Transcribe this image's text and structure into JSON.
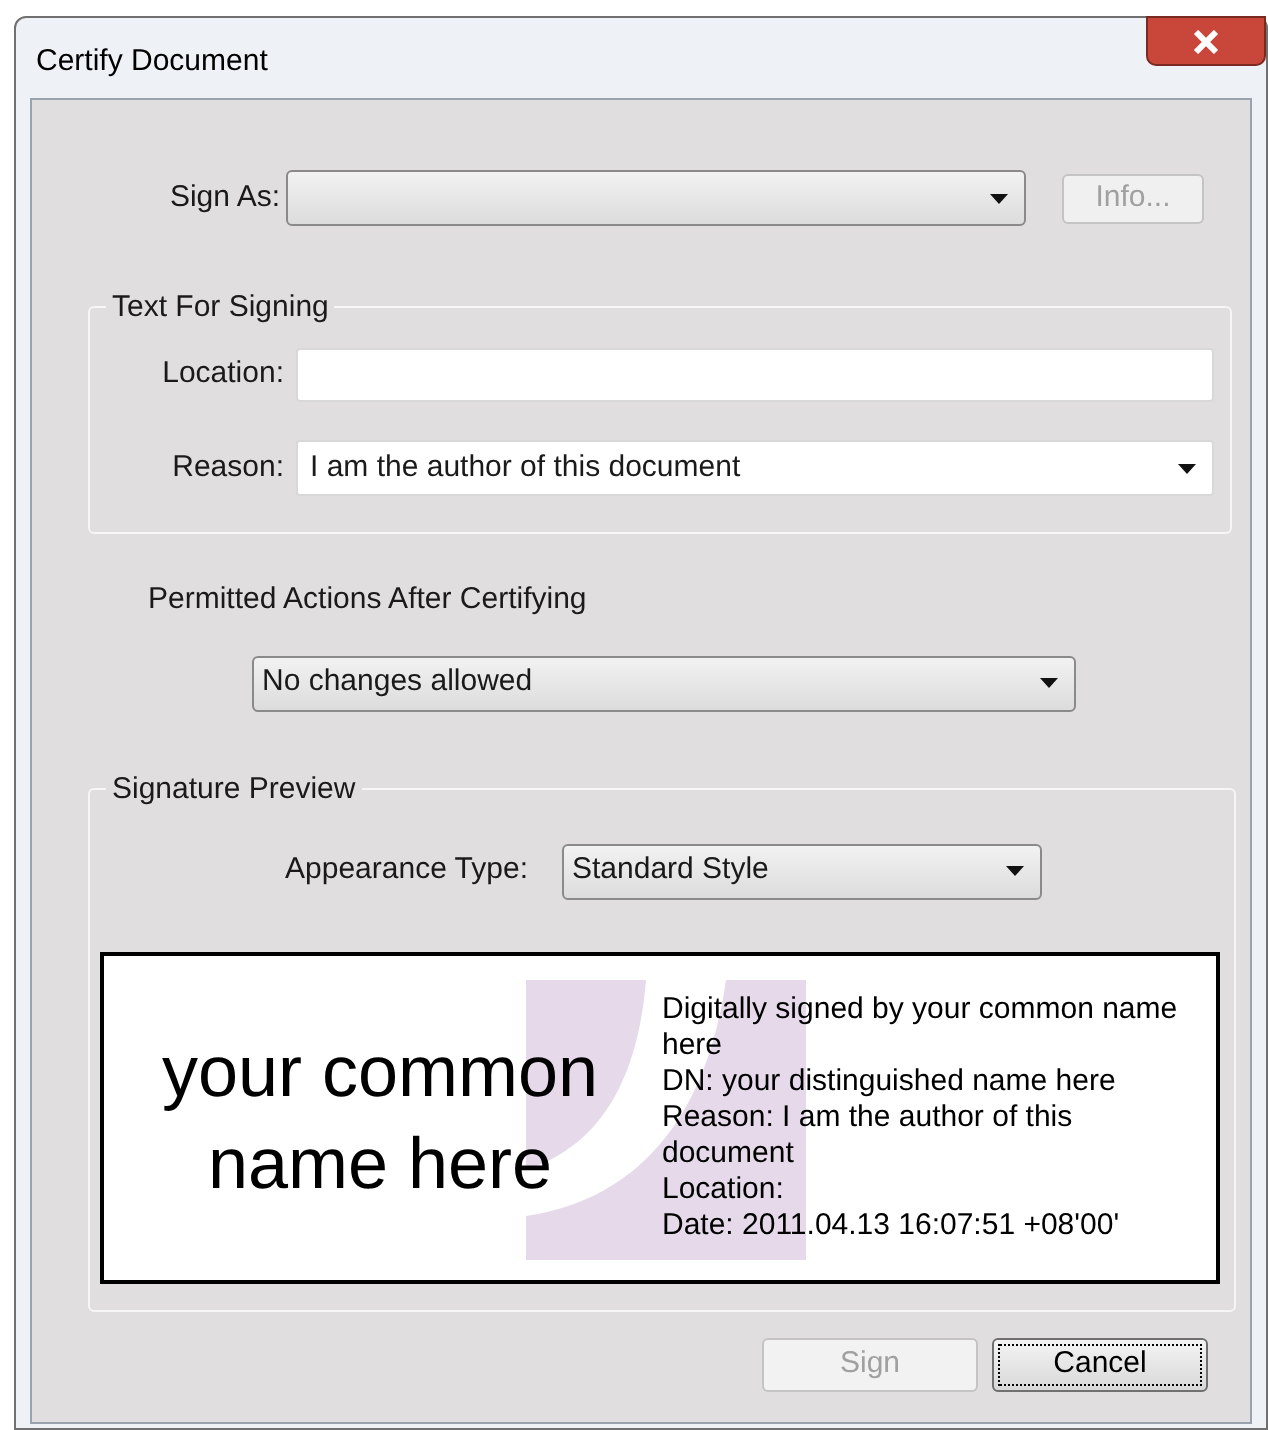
{
  "window": {
    "title": "Certify Document"
  },
  "sign_as": {
    "label": "Sign As:",
    "info_button": {
      "label": "Info...",
      "disabled": true
    }
  },
  "text_for_signing": {
    "title": "Text For Signing",
    "location": {
      "label": "Location:"
    },
    "reason": {
      "label": "Reason:",
      "value": "I am the author of this document"
    }
  },
  "permitted_actions": {
    "label": "Permitted Actions After Certifying",
    "value": "No changes allowed"
  },
  "signature_preview": {
    "title": "Signature Preview",
    "appearance_type": {
      "label": "Appearance Type:",
      "value": "Standard Style"
    },
    "name": "your common name here",
    "details": [
      "Digitally signed by your common name here",
      "DN: your distinguished name here",
      "Reason: I am the author of this document",
      "Location:",
      "Date: 2011.04.13 16:07:51 +08'00'"
    ]
  },
  "buttons": [
    {
      "label": "Sign",
      "disabled": true,
      "focused": false
    },
    {
      "label": "Cancel",
      "disabled": false,
      "focused": true
    }
  ]
}
